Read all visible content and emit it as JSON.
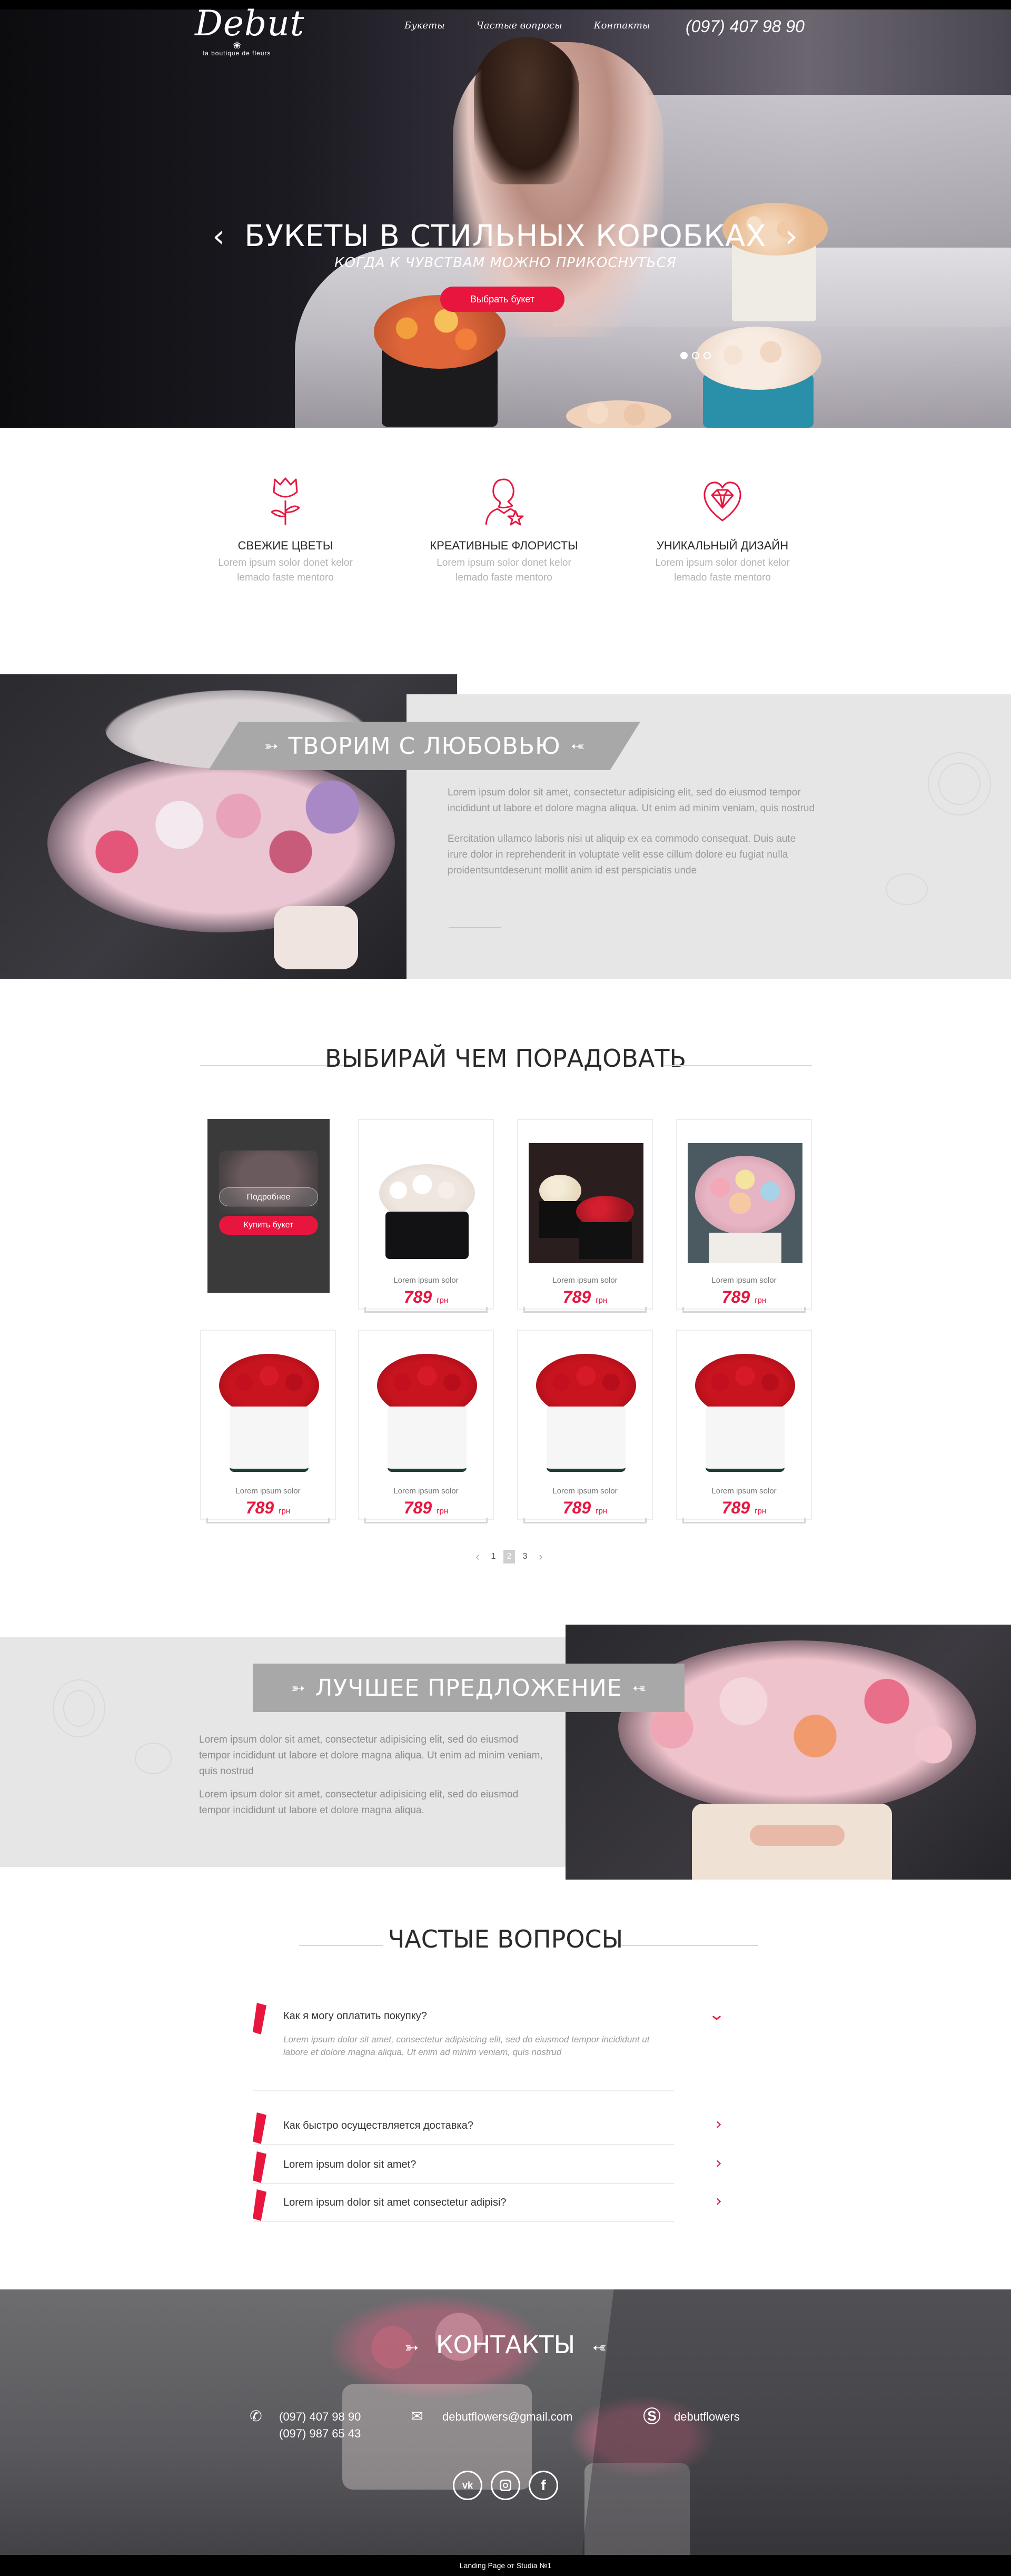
{
  "header": {
    "logo_text": "Debut",
    "logo_subtitle": "la boutique de fleurs",
    "nav": [
      "Букеты",
      "Частые вопросы",
      "Контакты"
    ],
    "phone": "(097) 407 98 90"
  },
  "hero": {
    "title": "БУКЕТЫ В СТИЛЬНЫХ КОРОБКАХ",
    "subtitle": "КОГДА К ЧУВСТВАМ МОЖНО ПРИКОСНУТЬСЯ",
    "cta": "Выбрать букет",
    "slides_count": 3,
    "active_slide": 1
  },
  "features": [
    {
      "icon": "rose-icon",
      "title": "СВЕЖИЕ ЦВЕТЫ",
      "text_line1": "Lorem ipsum solor donet kelor",
      "text_line2": "lemado faste mentoro"
    },
    {
      "icon": "florist-icon",
      "title": "КРЕАТИВНЫЕ ФЛОРИСТЫ",
      "text_line1": "Lorem ipsum solor donet kelor",
      "text_line2": "lemado faste mentoro"
    },
    {
      "icon": "diamond-heart-icon",
      "title": "УНИКАЛЬНЫЙ ДИЗАЙН",
      "text_line1": "Lorem ipsum solor donet kelor",
      "text_line2": "lemado faste mentoro"
    }
  ],
  "create": {
    "title": "ТВОРИМ С ЛЮБОВЬЮ",
    "paragraph1": "Lorem ipsum dolor sit amet, consectetur adipisicing elit, sed do eiusmod tempor incididunt ut labore et dolore magna aliqua. Ut enim ad minim veniam, quis nostrud",
    "paragraph2": "Eercitation ullamco laboris nisi ut aliquip ex ea commodo consequat. Duis aute irure dolor in reprehenderit in voluptate velit esse cillum dolore eu fugiat nulla  proidentsuntdeserunt mollit anim id est  perspiciatis unde"
  },
  "catalog": {
    "title": "ВЫБИРАЙ ЧЕМ ПОРАДОВАТЬ",
    "hover_more": "Подробнее",
    "hover_buy": "Купить букет",
    "products": [
      {
        "name": "Lorem ipsum solor",
        "price": "789",
        "currency": "грн"
      },
      {
        "name": "Lorem ipsum solor",
        "price": "789",
        "currency": "грн"
      },
      {
        "name": "Lorem ipsum solor",
        "price": "789",
        "currency": "грн"
      },
      {
        "name": "Lorem ipsum solor",
        "price": "789",
        "currency": "грн"
      },
      {
        "name": "Lorem ipsum solor",
        "price": "789",
        "currency": "грн"
      },
      {
        "name": "Lorem ipsum solor",
        "price": "789",
        "currency": "грн"
      },
      {
        "name": "Lorem ipsum solor",
        "price": "789",
        "currency": "грн"
      },
      {
        "name": "Lorem ipsum solor",
        "price": "789",
        "currency": "грн"
      }
    ],
    "pagination": [
      "1",
      "2",
      "3"
    ],
    "current_page": "2"
  },
  "offer": {
    "title": "ЛУЧШЕЕ ПРЕДЛОЖЕНИЕ",
    "paragraph1": "Lorem ipsum dolor sit amet, consectetur adipisicing elit, sed do eiusmod tempor incididunt ut labore et dolore magna aliqua. Ut enim ad minim veniam, quis nostrud",
    "paragraph2": "Lorem ipsum dolor sit amet, consectetur adipisicing elit, sed do eiusmod tempor incididunt ut labore et dolore magna aliqua."
  },
  "faq": {
    "title": "ЧАСТЫЕ ВОПРОСЫ",
    "items": [
      {
        "question": "Как я могу оплатить покупку?",
        "answer": "Lorem ipsum dolor sit amet, consectetur adipisicing elit, sed do eiusmod tempor incididunt ut labore et dolore magna aliqua. Ut enim ad minim veniam, quis nostrud",
        "expanded": true
      },
      {
        "question": "Как быстро осуществляется доставка?",
        "answer": "",
        "expanded": false
      },
      {
        "question": "Lorem ipsum dolor sit amet?",
        "answer": "",
        "expanded": false
      },
      {
        "question": "Lorem ipsum dolor sit amet consectetur adipisi?",
        "answer": "",
        "expanded": false
      }
    ]
  },
  "contacts": {
    "title": "КОНТАКТЫ",
    "phone1": "(097) 407 98 90",
    "phone2": "(097) 987 65 43",
    "email": "debutflowers@gmail.com",
    "skype": "debutflowers",
    "social": [
      "vk",
      "instagram",
      "facebook"
    ]
  },
  "footer": {
    "text": "Landing Page от Studia №1"
  },
  "colors": {
    "accent": "#e8163f",
    "panel_gray": "#e6e6e6",
    "ribbon_gray": "#a8a8a8",
    "dark": "#000000"
  }
}
